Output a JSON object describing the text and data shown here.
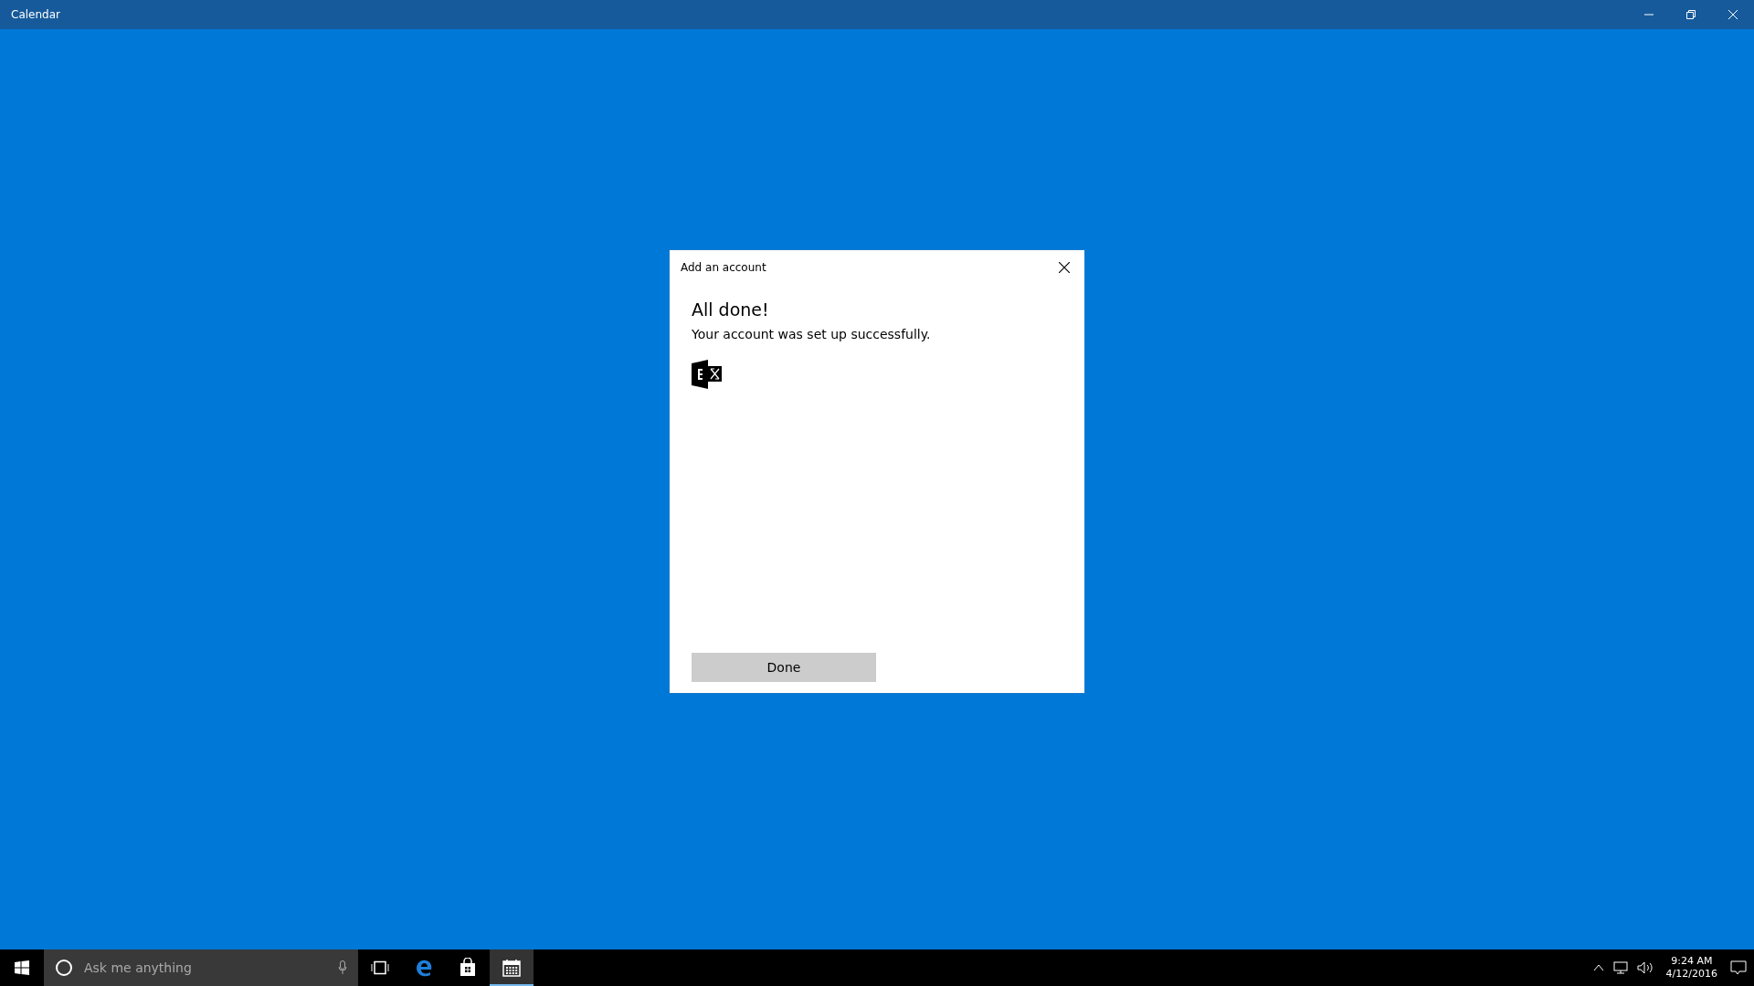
{
  "window": {
    "title": "Calendar"
  },
  "dialog": {
    "title": "Add an account",
    "heading": "All done!",
    "message": "Your account was set up successfully.",
    "button": "Done"
  },
  "taskbar": {
    "search": {
      "placeholder": "Ask me anything"
    },
    "apps": [
      {
        "kind": "edge",
        "selected": false
      },
      {
        "kind": "store",
        "selected": false
      },
      {
        "kind": "calendar",
        "selected": true
      }
    ],
    "time": "9:24 AM",
    "date": "4/12/2016"
  }
}
